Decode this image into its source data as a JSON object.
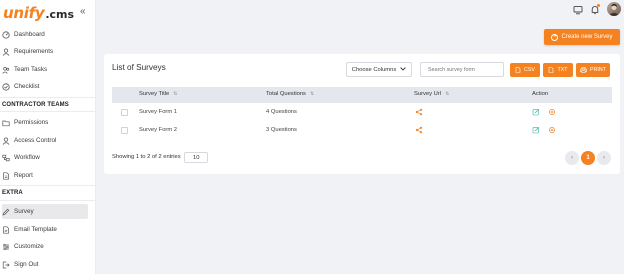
{
  "brand": {
    "logo_main": "unify",
    "logo_suffix": ".cms",
    "collapse": "«"
  },
  "sidebar": {
    "items": [
      {
        "label": "Dashboard",
        "icon": "dashboard-icon"
      },
      {
        "label": "Requirements",
        "icon": "user-icon"
      },
      {
        "label": "Team Tasks",
        "icon": "team-icon"
      },
      {
        "label": "Checklist",
        "icon": "checklist-icon"
      }
    ],
    "section_contractor": "CONTRACTOR TEAMS",
    "contractor_items": [
      {
        "label": "Permissions",
        "icon": "folder-icon"
      },
      {
        "label": "Access Control",
        "icon": "user-icon"
      },
      {
        "label": "Workflow",
        "icon": "workflow-icon"
      },
      {
        "label": "Report",
        "icon": "report-icon"
      }
    ],
    "section_extra": "EXTRA",
    "extra_items": [
      {
        "label": "Survey",
        "icon": "survey-icon",
        "active": true
      },
      {
        "label": "Email Template",
        "icon": "email-icon"
      },
      {
        "label": "Customize",
        "icon": "customize-icon"
      },
      {
        "label": "Sign Out",
        "icon": "sign-out-icon"
      }
    ]
  },
  "header": {
    "icons": [
      "monitor-icon",
      "bell-icon",
      "avatar"
    ],
    "create_button": "Create new Survey",
    "create_icon": "+"
  },
  "list": {
    "title": "List of Surveys",
    "choose_columns": "Choose Columns",
    "search_placeholder": "Search survey form",
    "exports": [
      "CSV",
      "TXT",
      "PRINT"
    ],
    "columns": [
      "Survey Title",
      "Total Questions",
      "Survey Url",
      "Action"
    ],
    "sort_glyph": "⇅",
    "rows": [
      {
        "title": "Survey Form 1",
        "questions": "4 Questions"
      },
      {
        "title": "Survey Form 2",
        "questions": "3 Questions"
      }
    ],
    "showing": "Showing 1 to 2 of 2 entries",
    "per_page": "10",
    "pagination": {
      "prev": "‹",
      "current": "1",
      "next": "›"
    }
  },
  "colors": {
    "accent": "#f58220",
    "sidebar_active": "#e9e9ec",
    "table_header": "#e4e7ee",
    "background": "#f1f2f6"
  }
}
